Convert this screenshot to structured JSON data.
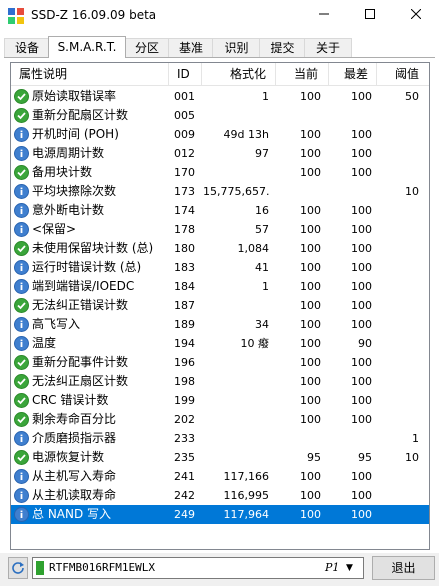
{
  "window": {
    "title": "SSD-Z 16.09.09 beta"
  },
  "tabs": [
    {
      "label": "设备",
      "active": false
    },
    {
      "label": "S.M.A.R.T.",
      "active": true
    },
    {
      "label": "分区",
      "active": false
    },
    {
      "label": "基准",
      "active": false
    },
    {
      "label": "识别",
      "active": false
    },
    {
      "label": "提交",
      "active": false
    },
    {
      "label": "关于",
      "active": false
    }
  ],
  "table": {
    "columns": [
      "属性说明",
      "ID",
      "格式化",
      "当前",
      "最差",
      "阈值"
    ],
    "rows": [
      {
        "icon": "check",
        "name": "原始读取错误率",
        "id": "001",
        "fmt": "1",
        "cur": "100",
        "worst": "100",
        "thr": "50"
      },
      {
        "icon": "check",
        "name": "重新分配扇区计数",
        "id": "005",
        "fmt": "",
        "cur": "",
        "worst": "",
        "thr": ""
      },
      {
        "icon": "info",
        "name": "开机时间 (POH)",
        "id": "009",
        "fmt": "49d 13h",
        "cur": "100",
        "worst": "100",
        "thr": ""
      },
      {
        "icon": "info",
        "name": "电源周期计数",
        "id": "012",
        "fmt": "97",
        "cur": "100",
        "worst": "100",
        "thr": ""
      },
      {
        "icon": "check",
        "name": "备用块计数",
        "id": "170",
        "fmt": "",
        "cur": "100",
        "worst": "100",
        "thr": ""
      },
      {
        "icon": "info",
        "name": "平均块擦除次数",
        "id": "173",
        "fmt": "15,775,657...",
        "cur": "",
        "worst": "",
        "thr": "10"
      },
      {
        "icon": "info",
        "name": "意外断电计数",
        "id": "174",
        "fmt": "16",
        "cur": "100",
        "worst": "100",
        "thr": ""
      },
      {
        "icon": "info",
        "name": "<保留>",
        "id": "178",
        "fmt": "57",
        "cur": "100",
        "worst": "100",
        "thr": ""
      },
      {
        "icon": "check",
        "name": "未使用保留块计数 (总)",
        "id": "180",
        "fmt": "1,084",
        "cur": "100",
        "worst": "100",
        "thr": ""
      },
      {
        "icon": "info",
        "name": "运行时错误计数 (总)",
        "id": "183",
        "fmt": "41",
        "cur": "100",
        "worst": "100",
        "thr": ""
      },
      {
        "icon": "info",
        "name": "端到端错误/IOEDC",
        "id": "184",
        "fmt": "1",
        "cur": "100",
        "worst": "100",
        "thr": ""
      },
      {
        "icon": "check",
        "name": "无法纠正错误计数",
        "id": "187",
        "fmt": "",
        "cur": "100",
        "worst": "100",
        "thr": ""
      },
      {
        "icon": "info",
        "name": "高飞写入",
        "id": "189",
        "fmt": "34",
        "cur": "100",
        "worst": "100",
        "thr": ""
      },
      {
        "icon": "info",
        "name": "温度",
        "id": "194",
        "fmt": "10 癈",
        "cur": "100",
        "worst": "90",
        "thr": ""
      },
      {
        "icon": "check",
        "name": "重新分配事件计数",
        "id": "196",
        "fmt": "",
        "cur": "100",
        "worst": "100",
        "thr": ""
      },
      {
        "icon": "check",
        "name": "无法纠正扇区计数",
        "id": "198",
        "fmt": "",
        "cur": "100",
        "worst": "100",
        "thr": ""
      },
      {
        "icon": "check",
        "name": "CRC 错误计数",
        "id": "199",
        "fmt": "",
        "cur": "100",
        "worst": "100",
        "thr": ""
      },
      {
        "icon": "check",
        "name": "剩余寿命百分比",
        "id": "202",
        "fmt": "",
        "cur": "100",
        "worst": "100",
        "thr": ""
      },
      {
        "icon": "info",
        "name": "介质磨损指示器",
        "id": "233",
        "fmt": "",
        "cur": "",
        "worst": "",
        "thr": "1"
      },
      {
        "icon": "check",
        "name": "电源恢复计数",
        "id": "235",
        "fmt": "",
        "cur": "95",
        "worst": "95",
        "thr": "10"
      },
      {
        "icon": "info",
        "name": "从主机写入寿命",
        "id": "241",
        "fmt": "117,166",
        "cur": "100",
        "worst": "100",
        "thr": ""
      },
      {
        "icon": "info",
        "name": "从主机读取寿命",
        "id": "242",
        "fmt": "116,995",
        "cur": "100",
        "worst": "100",
        "thr": ""
      },
      {
        "icon": "info",
        "name": "总 NAND 写入",
        "id": "249",
        "fmt": "117,964",
        "cur": "100",
        "worst": "100",
        "thr": "",
        "selected": true
      }
    ]
  },
  "bottom": {
    "drive_name": "RTFMB016RFM1EWLX",
    "drive_partition": "P1",
    "exit_label": "退出"
  },
  "colors": {
    "selection": "#0078d7",
    "ok_icon": "#3aa53a",
    "info_icon": "#3f7fcf",
    "drive_indicator": "#2fa12f"
  }
}
